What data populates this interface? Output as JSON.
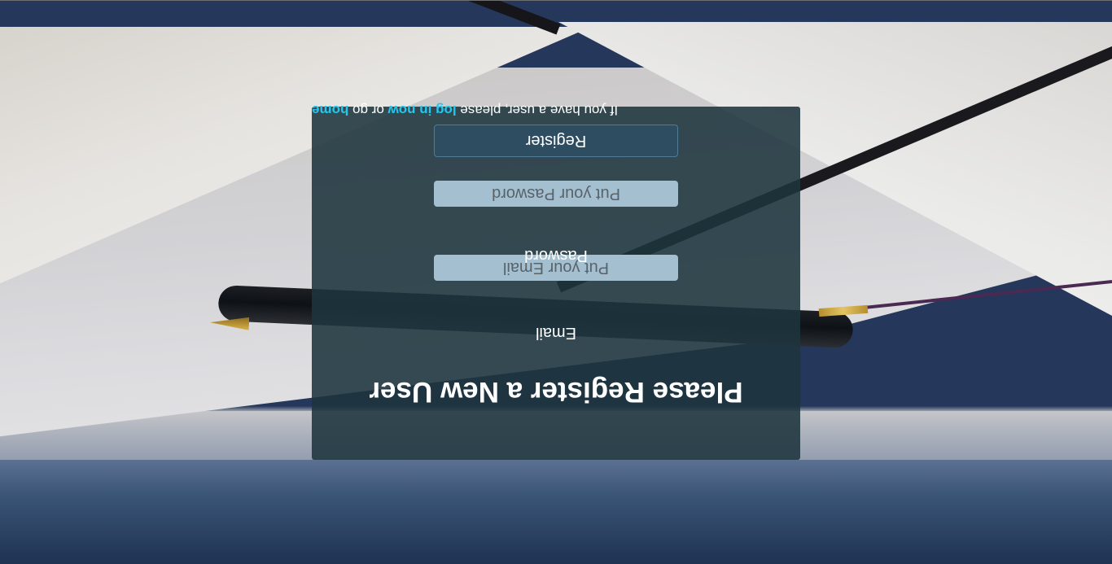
{
  "form": {
    "title": "Please Register a New User",
    "email_label": "Email",
    "email_placeholder": "Put your Email",
    "email_value": "",
    "password_label": "Pasword",
    "password_placeholder": "Put your Pasword",
    "password_value": "",
    "register_label": "Register"
  },
  "footer": {
    "prefix": "If you have a user, please ",
    "login_link": "log in now",
    "middle": " or go ",
    "home_link": "home"
  },
  "colors": {
    "panel_background": "#1e343e",
    "link": "#25c6ee",
    "input_background": "#a3bfd0",
    "button_background": "#2e4d61"
  },
  "orientation": "rotated 180 degrees"
}
